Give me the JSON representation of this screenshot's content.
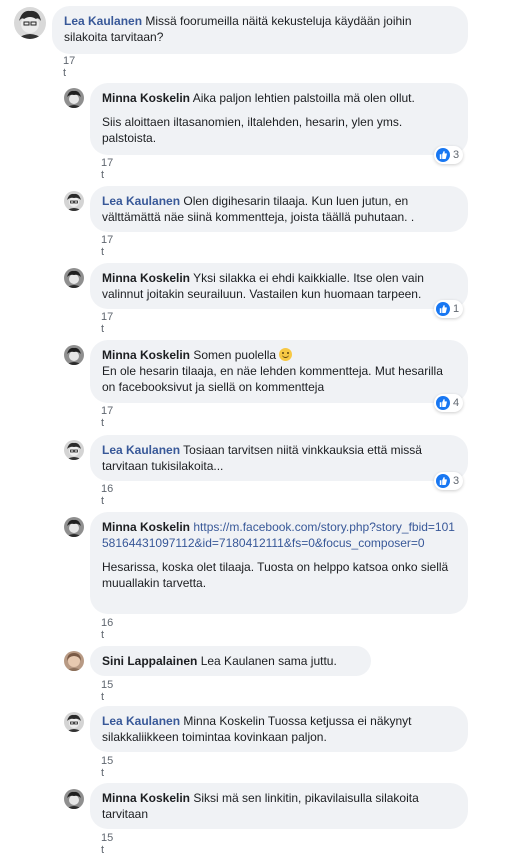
{
  "comments": [
    {
      "author": "Lea Kaulanen",
      "text": "Missä foorumeilla näitä kekusteluja käydään joihin silakoita tarvitaan?",
      "time": "17 t"
    },
    {
      "author": "Minna Koskelin",
      "text": "Aika paljon lehtien palstoilla mä olen ollut.",
      "text2": "Siis aloittaen iltasanomien, iltalehden, hesarin, ylen yms. palstoista.",
      "time": "17 t",
      "reactions": "3"
    },
    {
      "author": "Lea Kaulanen",
      "text": "Olen digihesarin tilaaja. Kun luen jutun, en välttämättä näe siinä kommentteja, joista täällä puhutaan. .",
      "time": "17 t"
    },
    {
      "author": "Minna Koskelin",
      "text": "Yksi silakka ei ehdi kaikkialle. Itse olen vain valinnut joitakin seurailuun. Vastailen kun huomaan tarpeen.",
      "time": "17 t",
      "reactions": "1"
    },
    {
      "author": "Minna Koskelin",
      "text": "Somen puolella",
      "text2": "En ole hesarin tilaaja, en näe lehden kommentteja. Mut hesarilla on facebooksivut ja siellä on kommentteja",
      "time": "17 t",
      "reactions": "4"
    },
    {
      "author": "Lea Kaulanen",
      "text": "Tosiaan tarvitsen niitä vinkkauksia että missä tarvitaan tukisilakoita...",
      "time": "16 t",
      "reactions": "3"
    },
    {
      "author": "Minna Koskelin",
      "link": "https://m.facebook.com/story.php?story_fbid=10158164431097112&id=7180412111&fs=0&focus_composer=0",
      "text2": "Hesarissa, koska olet tilaaja. Tuosta on helppo katsoa onko siellä muuallakin tarvetta.",
      "time": "16 t"
    },
    {
      "author": "Sini Lappalainen",
      "mention": "Lea Kaulanen",
      "text": "sama juttu.",
      "time": "15 t"
    },
    {
      "author": "Lea Kaulanen",
      "mention": "Minna Koskelin",
      "text": "Tuossa ketjussa ei näkynyt silakkaliikkeen toimintaa kovinkaan paljon.",
      "time": "15 t"
    },
    {
      "author": "Minna Koskelin",
      "text": "Siksi mä sen linkitin, pikavilaisulla silakoita tarvitaan",
      "time": "15 t"
    }
  ]
}
